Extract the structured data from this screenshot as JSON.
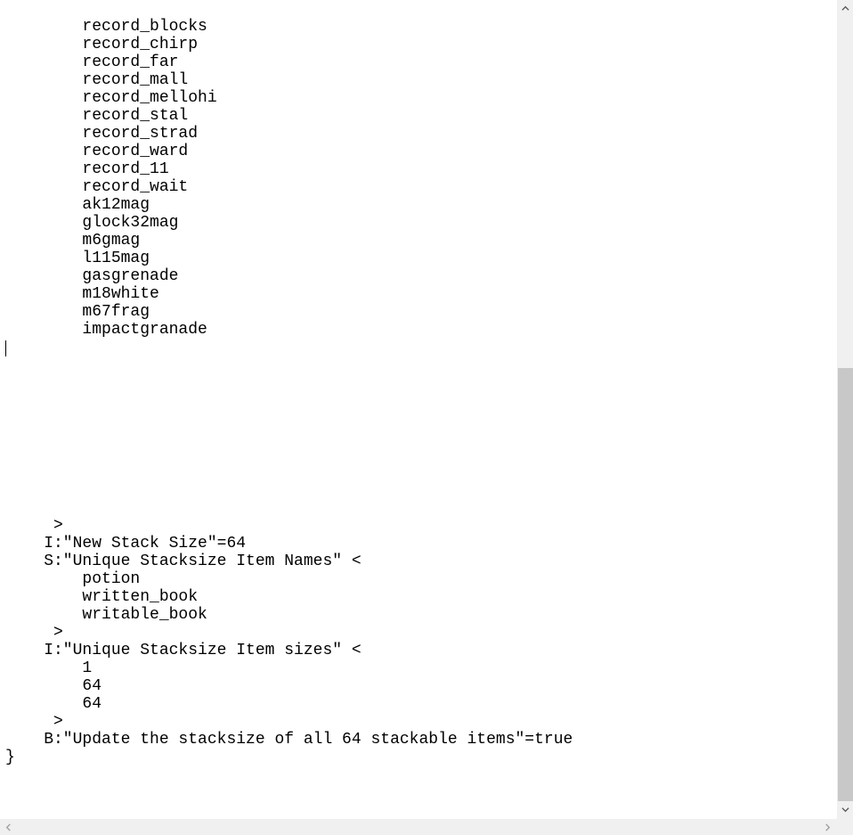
{
  "config": {
    "itemList": [
      "record_blocks",
      "record_chirp",
      "record_far",
      "record_mall",
      "record_mellohi",
      "record_stal",
      "record_strad",
      "record_ward",
      "record_11",
      "record_wait",
      "ak12mag",
      "glock32mag",
      "m6gmag",
      "l115mag",
      "gasgrenade",
      "m18white",
      "m67frag",
      "impactgranade"
    ],
    "closeBracket1": "     >",
    "newStackSize": {
      "key": "I:\"New Stack Size\"",
      "value": "64",
      "line": "    I:\"New Stack Size\"=64"
    },
    "uniqueNames": {
      "open": "    S:\"Unique Stacksize Item Names\" <",
      "items": [
        "potion",
        "written_book",
        "writable_book"
      ],
      "close": "     >"
    },
    "uniqueSizes": {
      "open": "    I:\"Unique Stacksize Item sizes\" <",
      "items": [
        "1",
        "64",
        "64"
      ],
      "close": "     >"
    },
    "updateAll": {
      "line": "    B:\"Update the stacksize of all 64 stackable items\"=true"
    },
    "closeBrace": "}"
  },
  "scrollbar": {
    "vThumbTop": 413,
    "vThumbHeight": 487
  }
}
